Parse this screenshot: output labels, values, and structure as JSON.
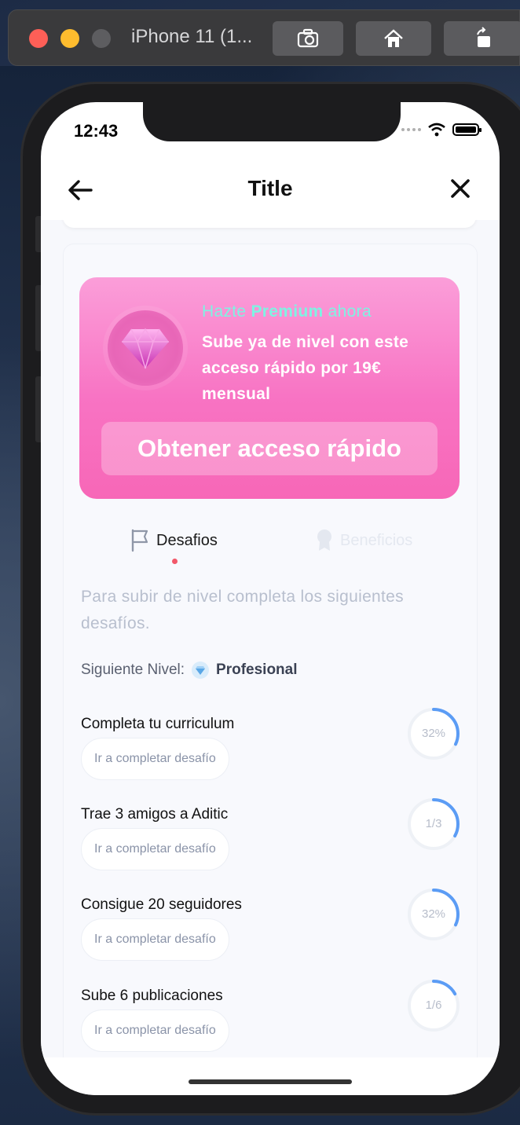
{
  "simulator": {
    "title": "iPhone 11 (1...",
    "buttons": [
      "screenshot-icon",
      "home-icon",
      "rotate-icon"
    ]
  },
  "status_bar": {
    "time": "12:43"
  },
  "nav": {
    "title": "Title",
    "back_icon": "arrow-left-icon",
    "close_icon": "close-icon"
  },
  "promo": {
    "head_prefix": "Hazte",
    "head_bold": "Premium",
    "head_suffix": "ahora",
    "body": "Sube ya de nivel con este acceso rápido por 19€ mensual",
    "button": "Obtener acceso rápido",
    "icon": "diamond-icon",
    "colors": {
      "top": "#fb9ed9",
      "bottom": "#f767b7",
      "headline": "#7ef3e2"
    }
  },
  "tabs": [
    {
      "label": "Desafios",
      "icon": "flag-icon",
      "active": true
    },
    {
      "label": "Beneficios",
      "icon": "badge-icon",
      "active": false
    }
  ],
  "intro": "Para subir de nivel completa los siguientes desafíos.",
  "next_level": {
    "label": "Siguiente Nivel:",
    "value": "Profesional",
    "icon": "level-icon"
  },
  "challenges": [
    {
      "title": "Completa tu curriculum",
      "button": "Ir a completar desafío",
      "progress_label": "32%",
      "progress": 0.32
    },
    {
      "title": "Trae 3 amigos a Aditic",
      "button": "Ir a completar desafío",
      "progress_label": "1/3",
      "progress": 0.33
    },
    {
      "title": "Consigue 20 seguidores",
      "button": "Ir a completar desafío",
      "progress_label": "32%",
      "progress": 0.32
    },
    {
      "title": "Sube 6 publicaciones",
      "button": "Ir a completar desafío",
      "progress_label": "1/6",
      "progress": 0.17
    }
  ],
  "colors": {
    "accent_blue": "#5b9cf5",
    "tab_dot": "#f2586a"
  }
}
